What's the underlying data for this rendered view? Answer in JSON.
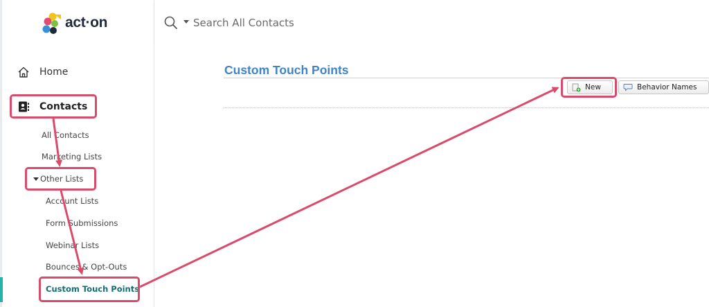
{
  "brand": {
    "name": "act·on"
  },
  "search": {
    "placeholder": "Search All Contacts"
  },
  "sidebar": {
    "home": "Home",
    "contacts": "Contacts",
    "items": [
      "All Contacts",
      "Marketing Lists",
      "Other Lists"
    ],
    "other_lists": [
      "Account Lists",
      "Form Submissions",
      "Webinar Lists",
      "Bounces & Opt-Outs",
      "Custom Touch Points"
    ]
  },
  "main": {
    "title": "Custom Touch Points",
    "toolbar": {
      "new_label": "New",
      "behavior_label": "Behavior Names"
    }
  },
  "colors": {
    "title": "#3f83c9",
    "active": "#0f6f73",
    "annotation": "#d94a6b"
  }
}
